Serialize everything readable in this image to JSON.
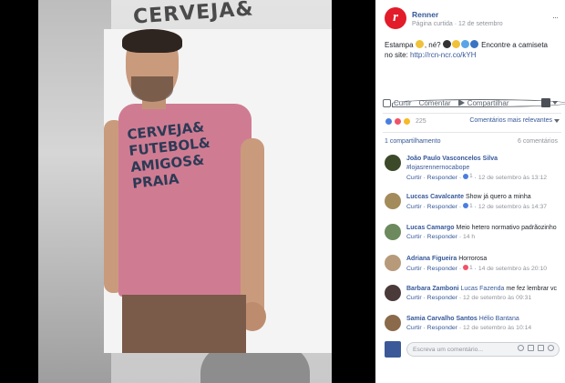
{
  "photo": {
    "bg_text": "CERVEJA&",
    "tee_print": [
      "CERVEJA&",
      "FUTEBOL&",
      "AMIGOS&",
      "PRAIA"
    ]
  },
  "post": {
    "page_name": "Renner",
    "page_logo": "r",
    "page_type": "Página curtida",
    "separator": "·",
    "date": "12 de setembro",
    "menu": "···",
    "text_prefix": "Estampa",
    "text_middle": ", né?",
    "text_suffix": " Encontre a camiseta no site: ",
    "link": "http://rcn-ncr.co/kYH"
  },
  "actions": {
    "like": "Curtir",
    "comment": "Comentar",
    "share": "Compartilhar"
  },
  "reactions": {
    "count": "225",
    "sort": "Comentários mais relevantes"
  },
  "counts": {
    "shares": "1 compartilhamento",
    "comments": "6 comentários"
  },
  "comments": [
    {
      "name": "João Paulo Vasconcelos Silva",
      "mention": "",
      "text": "",
      "mention_line": "#lojasrennernocabope",
      "like": "Curtir",
      "reply": "Responder",
      "reaction": "like",
      "reaction_count": "1",
      "time": "12 de setembro às 13:12",
      "avatar_color": "#3d4a2a"
    },
    {
      "name": "Luccas Cavalcante",
      "mention": "",
      "text": "Show já quero a minha",
      "mention_line": "",
      "like": "Curtir",
      "reply": "Responder",
      "reaction": "like",
      "reaction_count": "1",
      "time": "12 de setembro às 14:37",
      "avatar_color": "#a38b5b"
    },
    {
      "name": "Lucas Camargo",
      "mention": "",
      "text": "Meio hetero normativo padrãozinho",
      "mention_line": "",
      "like": "Curtir",
      "reply": "Responder",
      "reaction": "",
      "reaction_count": "",
      "time": "14 h",
      "avatar_color": "#6d8a5e"
    },
    {
      "name": "Adriana Figueira",
      "mention": "",
      "text": "Horrorosa",
      "mention_line": "",
      "like": "Curtir",
      "reply": "Responder",
      "reaction": "love",
      "reaction_count": "1",
      "time": "14 de setembro às 20:10",
      "avatar_color": "#b79a7a"
    },
    {
      "name": "Barbara Zamboni",
      "mention": "Lucas Fazenda",
      "text": "me fez lembrar vc",
      "mention_line": "",
      "like": "Curtir",
      "reply": "Responder",
      "reaction": "",
      "reaction_count": "",
      "time": "12 de setembro às 09:31",
      "avatar_color": "#4a3a3a"
    },
    {
      "name": "Samia Carvalho Santos",
      "mention": "Hélio Bantana",
      "text": "",
      "mention_line": "",
      "like": "Curtir",
      "reply": "Responder",
      "reaction": "",
      "reaction_count": "",
      "time": "12 de setembro às 10:14",
      "avatar_color": "#8a6a4a"
    }
  ],
  "composer": {
    "placeholder": "Escreva um comentário..."
  }
}
